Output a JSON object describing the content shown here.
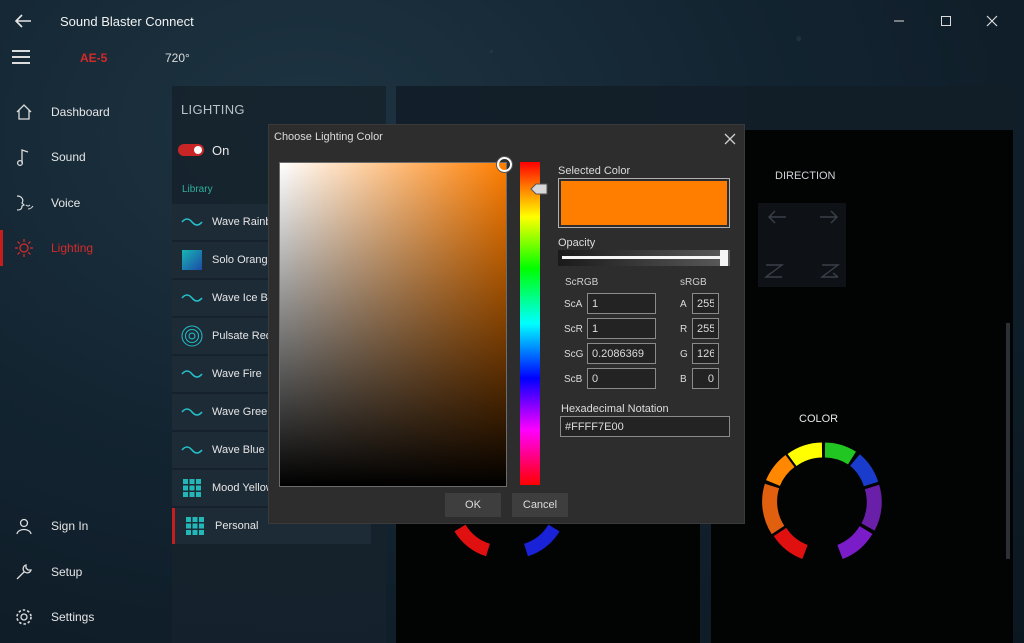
{
  "app": {
    "title": "Sound Blaster Connect",
    "device": "AE-5",
    "mode": "720°"
  },
  "window_controls": [
    "minimize",
    "maximize",
    "close"
  ],
  "sidebar": {
    "items": [
      {
        "label": "Dashboard",
        "icon": "home-icon"
      },
      {
        "label": "Sound",
        "icon": "music-note-icon"
      },
      {
        "label": "Voice",
        "icon": "voice-icon"
      },
      {
        "label": "Lighting",
        "icon": "sun-icon",
        "active": true
      }
    ],
    "bottom_items": [
      {
        "label": "Sign In",
        "icon": "user-icon"
      },
      {
        "label": "Setup",
        "icon": "wrench-icon"
      },
      {
        "label": "Settings",
        "icon": "gear-icon"
      }
    ]
  },
  "lighting": {
    "title": "LIGHTING",
    "toggle_label": "On",
    "toggle_on": true,
    "library_label": "Library",
    "items": [
      {
        "label": "Wave Rainbow",
        "icon": "wave-icon"
      },
      {
        "label": "Solo Orange",
        "icon": "solid-color-icon"
      },
      {
        "label": "Wave Ice Blue",
        "icon": "wave-icon"
      },
      {
        "label": "Pulsate Red",
        "icon": "pulsate-icon"
      },
      {
        "label": "Wave Fire",
        "icon": "wave-icon"
      },
      {
        "label": "Wave Green",
        "icon": "wave-icon"
      },
      {
        "label": "Wave Blue",
        "icon": "wave-icon"
      },
      {
        "label": "Mood Yellow",
        "icon": "grid-icon"
      },
      {
        "label": "Personal",
        "icon": "grid-icon",
        "selected": true
      }
    ]
  },
  "direction": {
    "title": "DIRECTION"
  },
  "color_section": {
    "title": "COLOR"
  },
  "dialog": {
    "title": "Choose Lighting Color",
    "selected_color_label": "Selected Color",
    "selected_color": "#ff7e00",
    "opacity_label": "Opacity",
    "opacity": 1,
    "scrgb_label": "ScRGB",
    "srgb_label": "sRGB",
    "scrgb": [
      {
        "label": "ScA",
        "value": "1"
      },
      {
        "label": "ScR",
        "value": "1"
      },
      {
        "label": "ScG",
        "value": "0.2086369"
      },
      {
        "label": "ScB",
        "value": "0"
      }
    ],
    "srgb": [
      {
        "label": "A",
        "value": "255"
      },
      {
        "label": "R",
        "value": "255"
      },
      {
        "label": "G",
        "value": "126"
      },
      {
        "label": "B",
        "value": "0"
      }
    ],
    "hex_label": "Hexadecimal Notation",
    "hex_value": "#FFFF7E00",
    "ok_label": "OK",
    "cancel_label": "Cancel"
  },
  "colors": {
    "accent": "#c41e1e",
    "library_label": "#2fae9a",
    "selected_color": "#ff7e00",
    "wheel_segments": [
      "#ffff00",
      "#22c622",
      "#1a3ccc",
      "#6a1fa8",
      "#7a1cc8",
      "#e01010",
      "#e06010",
      "#ff8800"
    ]
  }
}
